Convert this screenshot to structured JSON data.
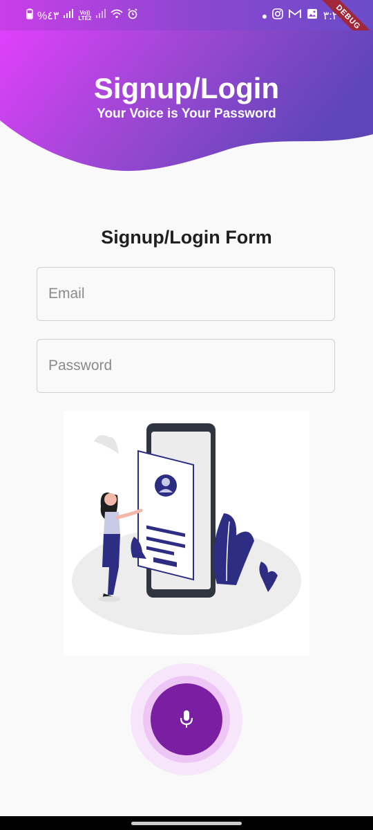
{
  "status_bar": {
    "battery_percent": "%٤٣",
    "network_label": "LTE2",
    "volte_label": "Vo))",
    "time": "٣:٢١",
    "icons": [
      "battery-icon",
      "signal-icon",
      "volte-icon",
      "signal-icon",
      "wifi-icon",
      "alarm-icon",
      "dot-icon",
      "instagram-icon",
      "gmail-icon",
      "gallery-icon"
    ]
  },
  "debug_banner": "DEBUG",
  "header": {
    "title": "Signup/Login",
    "subtitle": "Your Voice is Your Password",
    "gradient": [
      "#e040fb",
      "#5e46b8"
    ]
  },
  "form": {
    "title": "Signup/Login Form",
    "email_placeholder": "Email",
    "password_placeholder": "Password"
  },
  "mic": {
    "icon": "microphone-icon",
    "color": "#7b1fa2"
  },
  "colors": {
    "background": "#f9f9f9",
    "accent": "#7b1fa2"
  }
}
